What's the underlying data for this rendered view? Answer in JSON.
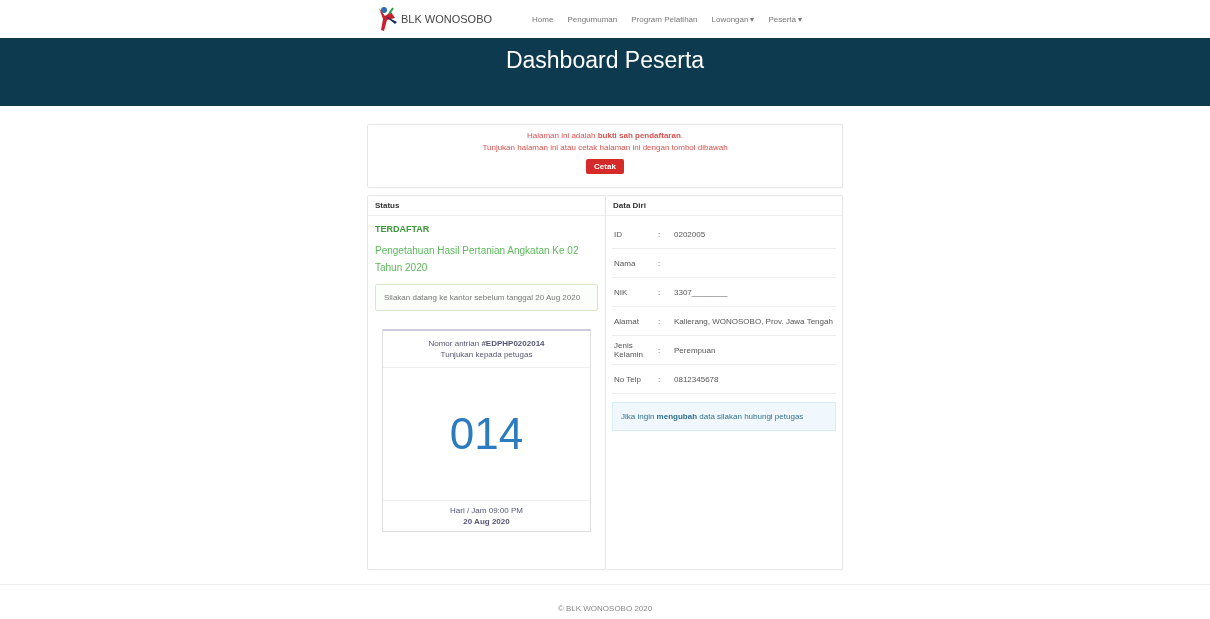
{
  "navbar": {
    "brand": "BLK WONOSOBO",
    "links": [
      {
        "label": "Home",
        "dropdown": false
      },
      {
        "label": "Pengumuman",
        "dropdown": false
      },
      {
        "label": "Program Pelatihan",
        "dropdown": false
      },
      {
        "label": "Lowongan",
        "dropdown": true
      },
      {
        "label": "Peserta",
        "dropdown": true
      }
    ],
    "caret": "▾"
  },
  "banner": {
    "title": "Dashboard Peserta"
  },
  "notice": {
    "line_1": "Halaman ini adalah **bukti sah pendaftaran**.",
    "line_2": "Tunjukan halaman ini atau cetak halaman ini dengan tombol dibawah",
    "button": "Cetak"
  },
  "status": {
    "heading": "Status",
    "state": "TERDAFTAR",
    "program": "Pengetahuan Hasil Pertanian Angkatan Ke 02 Tahun 2020",
    "alert": "Silakan datang ke kantor sebelum tanggal 20 Aug 2020",
    "queue": {
      "label": "Nomor antrian **#EDPHP0202014**",
      "sub": "Tunjukan kepada petugas",
      "number": "014",
      "time": "Hari / Jam 09:00 PM",
      "date": "20 Aug 2020"
    }
  },
  "data_diri": {
    "heading": "Data Diri",
    "rows": [
      {
        "label": "ID",
        "colon": ":",
        "value": "0202005"
      },
      {
        "label": "Nama",
        "colon": ":"
      },
      {
        "label": "NIK",
        "colon": ":",
        "value": "3307________"
      },
      {
        "label": "Alamat",
        "colon": ":",
        "value": "Kalierang, WONOSOBO, Prov. Jawa Tengah"
      },
      {
        "label": "Jenis Kelamin",
        "colon": ":",
        "value": "Perempuan"
      },
      {
        "label": "No Telp",
        "colon": ":",
        "value": "0812345678"
      }
    ],
    "info": "Jika ingin **mengubah** data silakan hubungi petugas"
  },
  "footer": {
    "text": "© BLK WONOSOBO 2020"
  }
}
